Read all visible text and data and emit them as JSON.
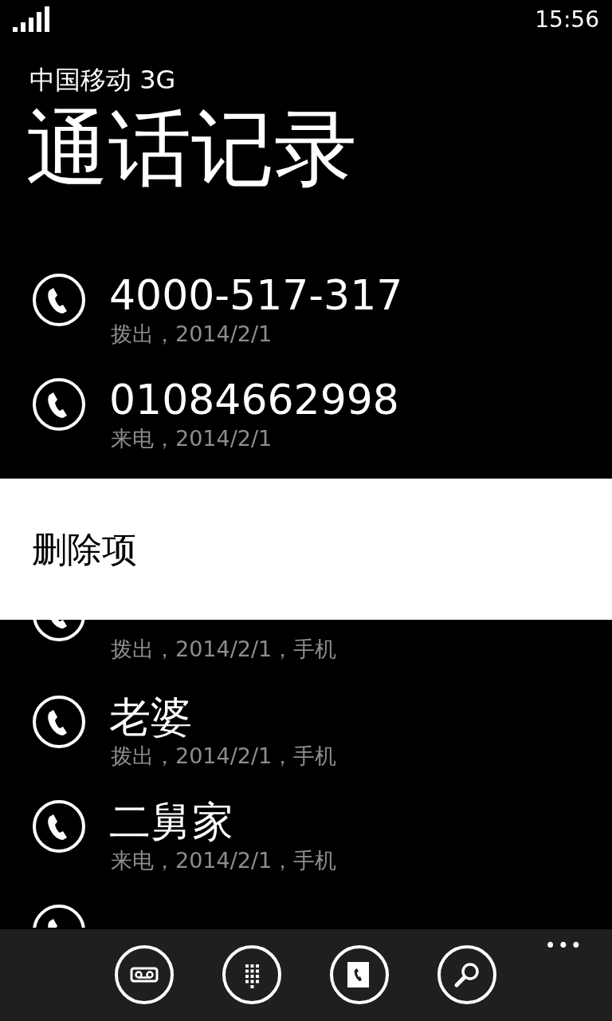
{
  "status_bar": {
    "time": "15:56"
  },
  "header": {
    "carrier": "中国移动 3G",
    "title": "通话记录"
  },
  "calls": [
    {
      "kind": "full",
      "name": "4000-517-317",
      "detail": "拨出，2014/2/1"
    },
    {
      "kind": "full",
      "name": "01084662998",
      "detail": "来电，2014/2/1"
    },
    {
      "kind": "partial",
      "detail": "拨出，2014/2/1，手机"
    },
    {
      "kind": "full",
      "name": "老婆",
      "detail": "拨出，2014/2/1，手机"
    },
    {
      "kind": "full",
      "name": "二舅家",
      "detail": "来电，2014/2/1，手机"
    },
    {
      "kind": "full"
    }
  ],
  "context_menu": {
    "items": [
      "删除项"
    ]
  },
  "app_bar": {
    "buttons": [
      {
        "kind": "voicemail"
      },
      {
        "kind": "keypad"
      },
      {
        "kind": "contacts"
      },
      {
        "kind": "search"
      }
    ],
    "more": "•••"
  }
}
